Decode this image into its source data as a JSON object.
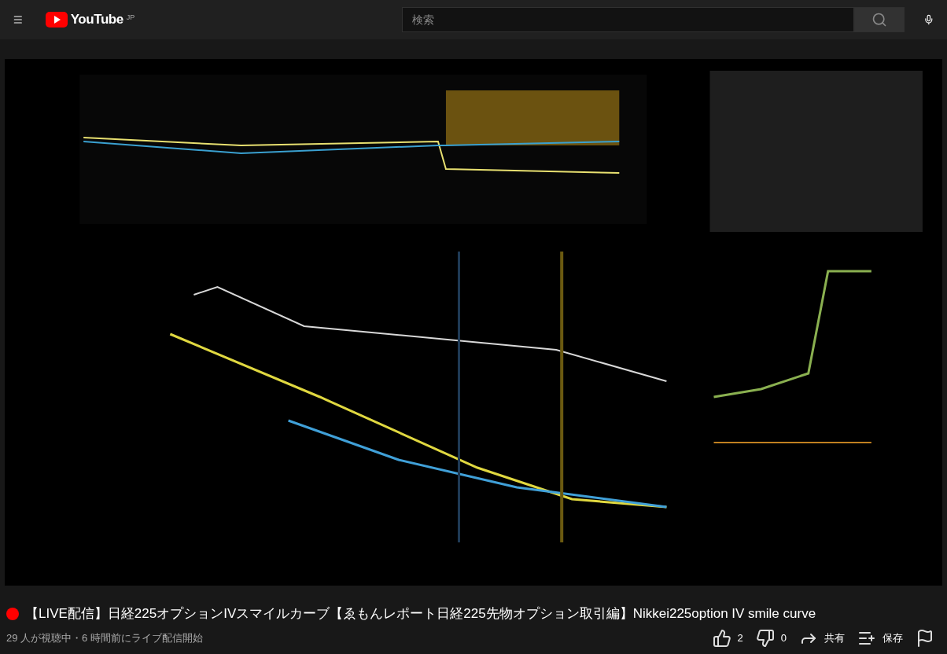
{
  "header": {
    "logo": "YouTube",
    "region": "JP",
    "search": {
      "placeholder": "検索"
    }
  },
  "live": true,
  "title": "【LIVE配信】日経225オプションIVスマイルカーブ【ゑもんレポート日経225先物オプション取引編】Nikkei225option IV smile curve",
  "meta": "29 人が視聴中・6 時間前にライブ配信開始",
  "actions": [
    {
      "kind": "like",
      "label": "2"
    },
    {
      "kind": "dislike",
      "label": "0"
    },
    {
      "kind": "share",
      "label": "共有"
    },
    {
      "kind": "save",
      "label": "保存"
    },
    {
      "kind": "report"
    }
  ]
}
